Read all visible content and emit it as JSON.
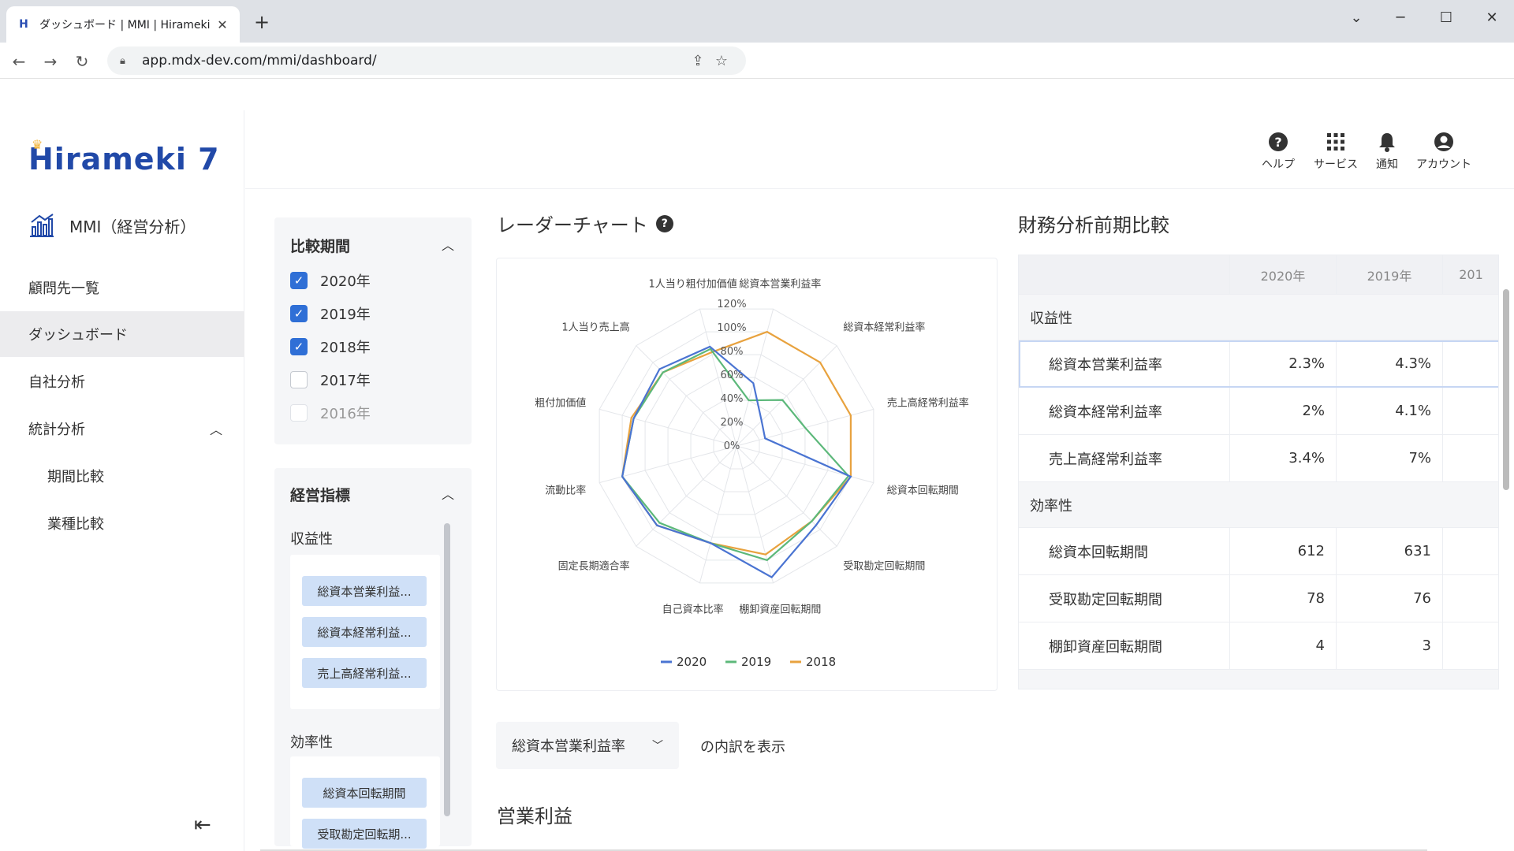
{
  "browser": {
    "tab_title": "ダッシュボード | MMI | Hirameki 7",
    "url": "app.mdx-dev.com/mmi/dashboard/"
  },
  "brand": {
    "logo": "Hirameki 7",
    "module": "MMI（経営分析）",
    "accent": "#2149a8"
  },
  "sidebar": {
    "items": [
      {
        "label": "顧問先一覧"
      },
      {
        "label": "ダッシュボード"
      },
      {
        "label": "自社分析"
      },
      {
        "label": "統計分析"
      },
      {
        "label": "期間比較"
      },
      {
        "label": "業種比較"
      }
    ]
  },
  "header": {
    "help": "ヘルプ",
    "services": "サービス",
    "notify": "通知",
    "account": "アカウント"
  },
  "filters": {
    "period_title": "比較期間",
    "years": [
      {
        "label": "2020年",
        "state": "checked"
      },
      {
        "label": "2019年",
        "state": "checked"
      },
      {
        "label": "2018年",
        "state": "checked"
      },
      {
        "label": "2017年",
        "state": "unchecked"
      },
      {
        "label": "2016年",
        "state": "disabled"
      }
    ],
    "indicator_title": "経営指標",
    "profit_group": "収益性",
    "profit_chips": [
      "総資本営業利益...",
      "総資本経常利益...",
      "売上高経常利益..."
    ],
    "eff_group": "効率性",
    "eff_chips": [
      "総資本回転期間",
      "受取勘定回転期..."
    ]
  },
  "radar": {
    "title": "レーダーチャート",
    "help_glyph": "?"
  },
  "chart_data": {
    "type": "radar",
    "axes": [
      "総資本営業利益率",
      "総資本経常利益率",
      "売上高経常利益率",
      "総資本回転期間",
      "受取勘定回転期間",
      "棚卸資産回転期間",
      "自己資本比率",
      "固定長期適合率",
      "流動比率",
      "粗付加価値",
      "1人当り売上高",
      "1人当り粗付加価値"
    ],
    "ticks": [
      "0%",
      "20%",
      "40%",
      "60%",
      "80%",
      "100%",
      "120%"
    ],
    "rmax": 120,
    "series": [
      {
        "name": "2020",
        "color": "#4a74d2",
        "values": [
          55,
          30,
          25,
          100,
          95,
          115,
          85,
          95,
          100,
          90,
          92,
          87
        ]
      },
      {
        "name": "2019",
        "color": "#5cb87a",
        "values": [
          40,
          55,
          60,
          98,
          90,
          100,
          85,
          92,
          100,
          90,
          88,
          85
        ]
      },
      {
        "name": "2018",
        "color": "#e8a23e",
        "values": [
          100,
          100,
          100,
          100,
          90,
          95,
          85,
          95,
          100,
          92,
          88,
          82
        ]
      }
    ]
  },
  "table": {
    "title": "財務分析前期比較",
    "columns": [
      "",
      "2020年",
      "2019年",
      "201"
    ],
    "rows": [
      {
        "section": "収益性"
      },
      {
        "label": "総資本営業利益率",
        "v2020": "2.3%",
        "v2019": "4.3%"
      },
      {
        "label": "総資本経常利益率",
        "v2020": "2%",
        "v2019": "4.1%"
      },
      {
        "label": "売上高経常利益率",
        "v2020": "3.4%",
        "v2019": "7%"
      },
      {
        "section": "効率性"
      },
      {
        "label": "総資本回転期間",
        "v2020": "612",
        "v2019": "631"
      },
      {
        "label": "受取勘定回転期間",
        "v2020": "78",
        "v2019": "76"
      },
      {
        "label": "棚卸資産回転期間",
        "v2020": "4",
        "v2019": "3"
      }
    ]
  },
  "breakdown": {
    "selected": "総資本営業利益率",
    "suffix": "の内訳を表示",
    "section_title": "営業利益"
  }
}
